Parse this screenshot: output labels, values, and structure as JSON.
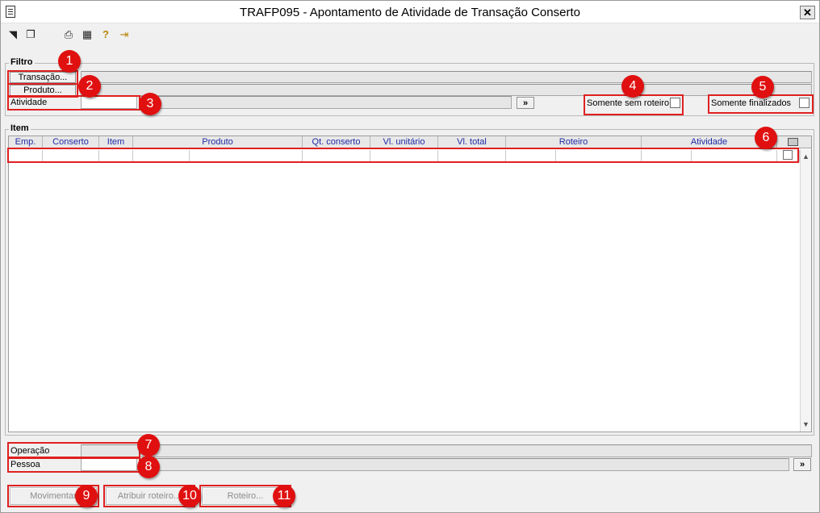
{
  "window": {
    "title": "TRAFP095 - Apontamento de Atividade de Transação Conserto",
    "close_glyph": "✕"
  },
  "toolbar": [
    {
      "name": "export-icon",
      "glyph": "◥"
    },
    {
      "name": "copy-icon",
      "glyph": "❐"
    },
    {
      "name": "print-icon",
      "glyph": "⎙"
    },
    {
      "name": "calendar-icon",
      "glyph": "▦"
    },
    {
      "name": "help-icon",
      "glyph": "?"
    },
    {
      "name": "exit-door-icon",
      "glyph": "⇥"
    }
  ],
  "filtro": {
    "label": "Filtro",
    "transacao_button": "Transação...",
    "produto_button": "Produto...",
    "atividade_label": "Atividade",
    "atividade_value": "",
    "lookup_button": "»",
    "somente_sem_roteiro": "Somente sem roteiro",
    "somente_finalizados": "Somente finalizados"
  },
  "item": {
    "label": "Item",
    "columns": [
      "Emp.",
      "Conserto",
      "Item",
      "Produto",
      "Qt. conserto",
      "Vl. unitário",
      "Vl. total",
      "Roteiro",
      "Atividade"
    ],
    "rows": [
      [
        "",
        "",
        "",
        "",
        "",
        "",
        "",
        "",
        ""
      ]
    ]
  },
  "bottom": {
    "operacao_label": "Operação",
    "operacao_value": "",
    "pessoa_label": "Pessoa",
    "pessoa_value": "",
    "lookup_button": "»"
  },
  "actions": {
    "movimentar": "Movimentar",
    "atribuir_roteiro": "Atribuir roteiro...",
    "roteiro": "Roteiro..."
  },
  "markers": [
    "1",
    "2",
    "3",
    "4",
    "5",
    "6",
    "7",
    "8",
    "9",
    "10",
    "11"
  ]
}
